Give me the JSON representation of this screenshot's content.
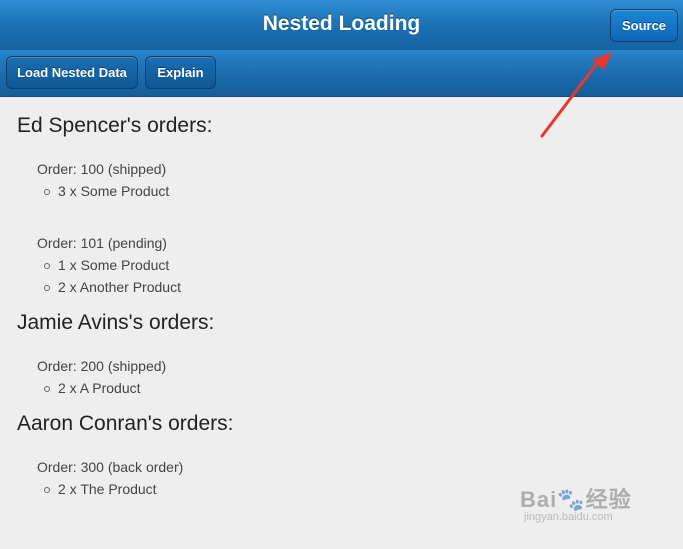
{
  "header": {
    "title": "Nested Loading",
    "source_label": "Source"
  },
  "toolbar": {
    "load_label": "Load Nested Data",
    "explain_label": "Explain"
  },
  "customers": [
    {
      "heading": "Ed Spencer's orders:",
      "orders": [
        {
          "label": "Order: 100 (shipped)",
          "items": [
            "3 x Some Product"
          ]
        },
        {
          "label": "Order: 101 (pending)",
          "items": [
            "1 x Some Product",
            "2 x Another Product"
          ]
        }
      ]
    },
    {
      "heading": "Jamie Avins's orders:",
      "orders": [
        {
          "label": "Order: 200 (shipped)",
          "items": [
            "2 x A Product"
          ]
        }
      ]
    },
    {
      "heading": "Aaron Conran's orders:",
      "orders": [
        {
          "label": "Order: 300 (back order)",
          "items": [
            "2 x The Product"
          ]
        }
      ]
    }
  ],
  "watermark": {
    "brand": "Bai🐾经验",
    "url": "jingyan.baidu.com"
  },
  "colors": {
    "accent": "#1a6fb0",
    "annotation_arrow": "#e8372c"
  }
}
